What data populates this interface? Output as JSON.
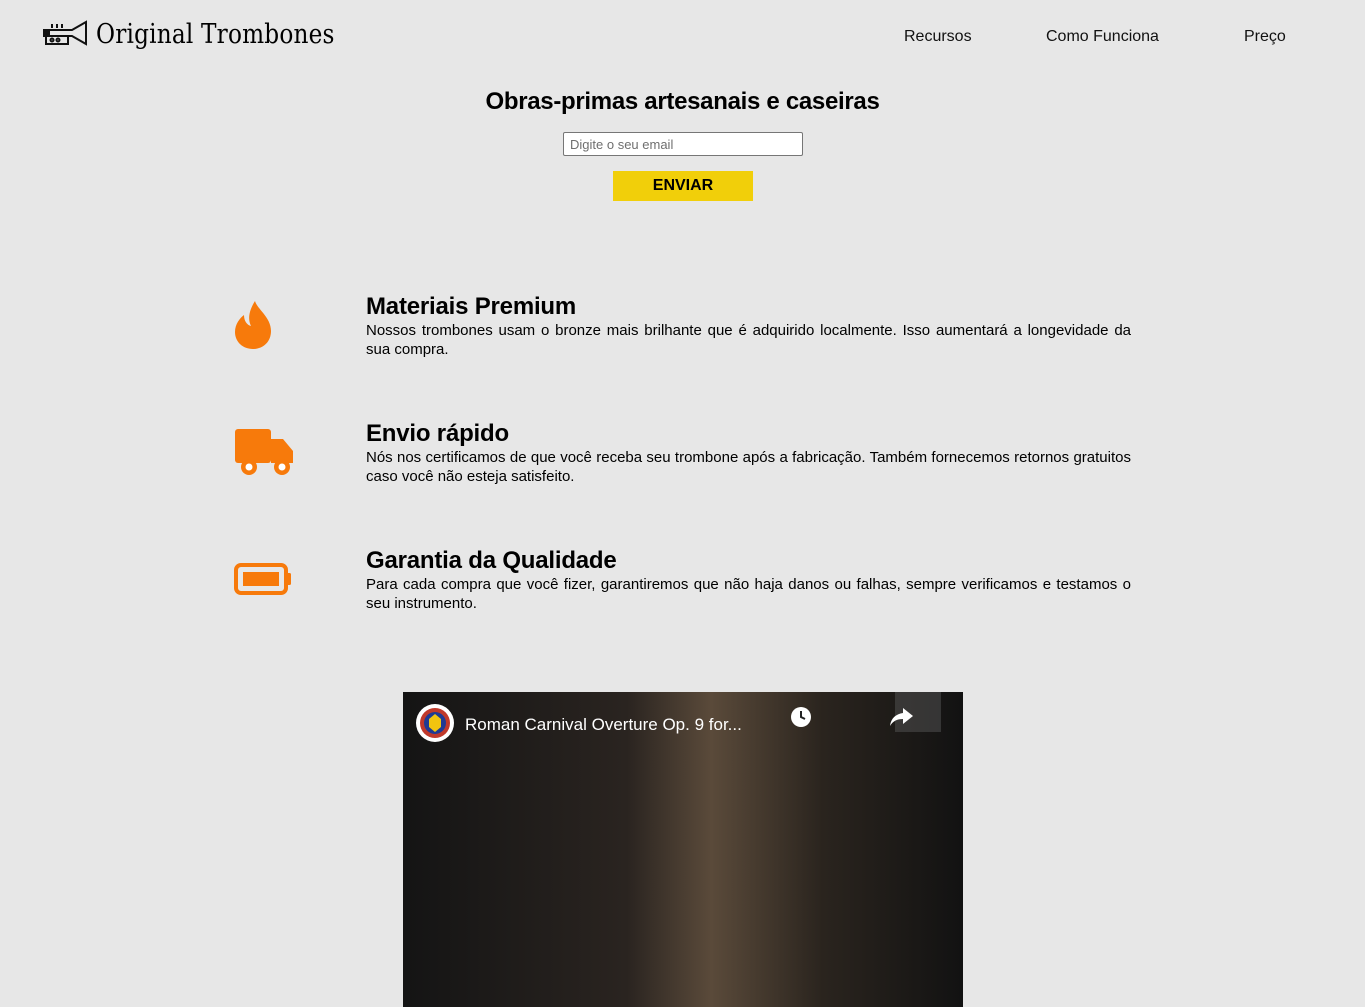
{
  "header": {
    "logo_text": "Original Trombones",
    "logo_icon": "trumpet-icon",
    "nav": [
      {
        "label": "Recursos"
      },
      {
        "label": "Como Funciona"
      },
      {
        "label": "Preço"
      }
    ]
  },
  "hero": {
    "title": "Obras-primas artesanais e caseiras",
    "email_placeholder": "Digite o seu email",
    "button_label": "ENVIAR"
  },
  "features": [
    {
      "icon": "fire-icon",
      "title": "Materiais Premium",
      "text": "Nossos trombones usam o bronze mais brilhante que é adquirido localmente. Isso aumentará a longevidade da sua compra."
    },
    {
      "icon": "truck-icon",
      "title": "Envio rápido",
      "text": "Nós nos certificamos de que você receba seu trombone após a fabricação. Também fornecemos retornos gratuitos caso você não esteja satisfeito."
    },
    {
      "icon": "battery-icon",
      "title": "Garantia da Qualidade",
      "text": "Para cada compra que você fizer, garantiremos que não haja danos ou falhas, sempre verificamos e testamos o seu instrumento."
    }
  ],
  "video": {
    "title": "Roman Carnival Overture Op. 9 for..."
  },
  "colors": {
    "accent_yellow": "#f1cf0a",
    "icon_orange": "#f77a0b",
    "background": "#e7e7e7"
  }
}
